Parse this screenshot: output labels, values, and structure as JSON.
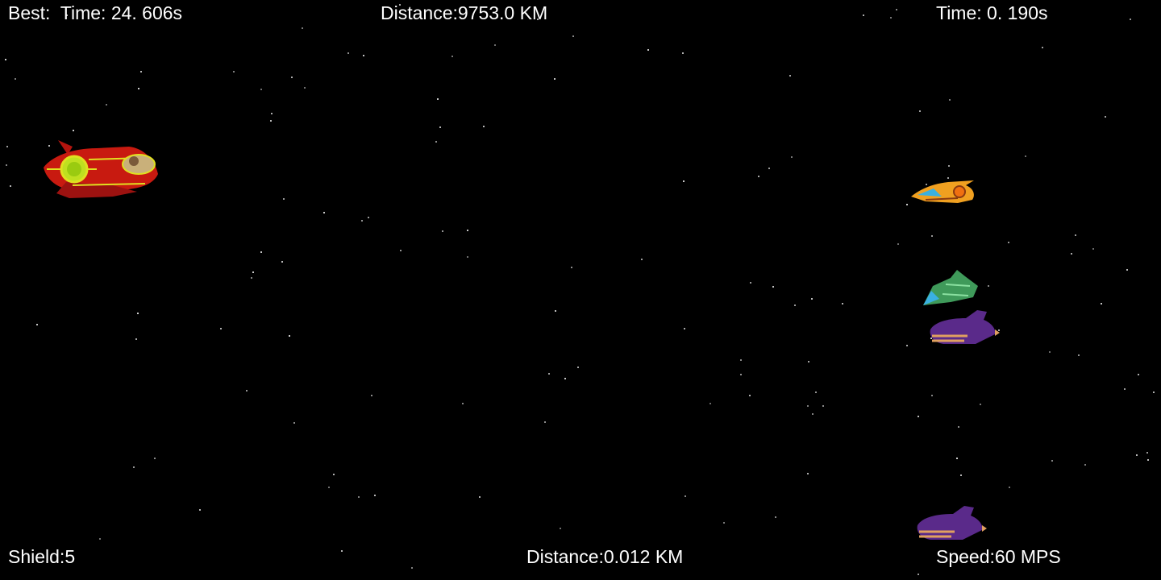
{
  "hud": {
    "best": "Best:  Time: 24. 606s",
    "best_distance": "Distance:9753.0 KM",
    "time": "Time: 0. 190s",
    "shield": "Shield:5",
    "distance": "Distance:0.012 KM",
    "speed": "Speed:60 MPS"
  },
  "sprites": {
    "player": "red-spaceship-with-pilot",
    "enemies": [
      "orange-fighter-ship",
      "green-fighter-ship",
      "purple-cruiser-ship",
      "purple-cruiser-ship"
    ]
  },
  "colors": {
    "background": "#000000",
    "text": "#ffffff",
    "player_hull": "#c81a10",
    "player_accent": "#e0e020",
    "enemy_orange": "#f0a020",
    "enemy_green": "#3f9a5a",
    "enemy_purple": "#5a2a8a"
  }
}
